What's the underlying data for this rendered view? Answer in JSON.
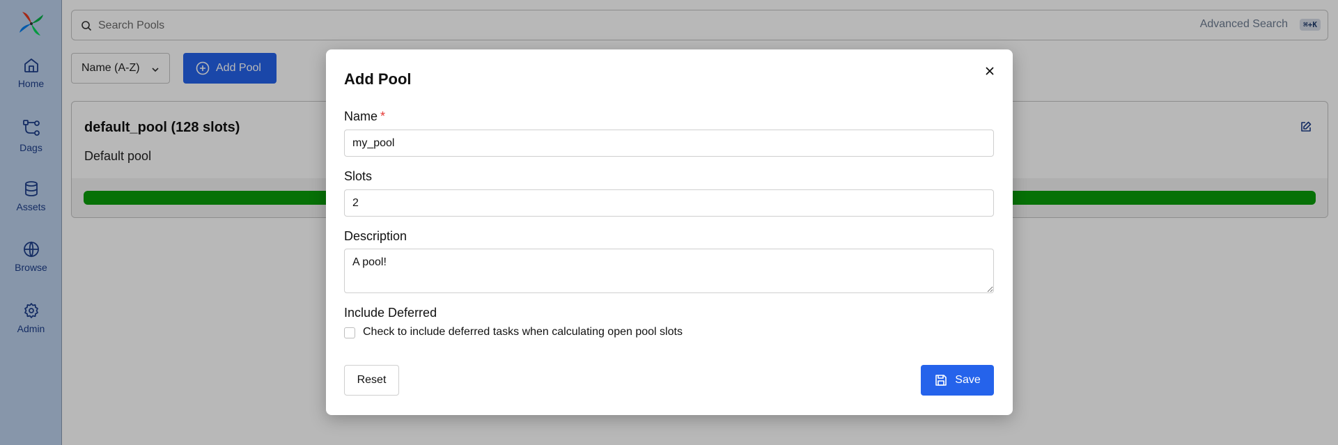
{
  "sidebar": {
    "items": [
      {
        "label": "Home",
        "icon": "home-icon"
      },
      {
        "label": "Dags",
        "icon": "dags-icon"
      },
      {
        "label": "Assets",
        "icon": "database-icon"
      },
      {
        "label": "Browse",
        "icon": "globe-icon"
      },
      {
        "label": "Admin",
        "icon": "gear-icon"
      }
    ]
  },
  "search": {
    "placeholder": "Search Pools",
    "advanced_label": "Advanced Search",
    "shortcut": "⌘+K"
  },
  "toolbar": {
    "sort_value": "Name (A-Z)",
    "add_pool_label": "Add Pool"
  },
  "pool_card": {
    "title": "default_pool (128 slots)",
    "description": "Default pool",
    "bar_color": "#0a9d0a"
  },
  "modal": {
    "title": "Add Pool",
    "name_label": "Name",
    "required_mark": "*",
    "name_value": "my_pool",
    "slots_label": "Slots",
    "slots_value": "2",
    "description_label": "Description",
    "description_value": "A pool!",
    "include_deferred_label": "Include Deferred",
    "include_deferred_text": "Check to include deferred tasks when calculating open pool slots",
    "include_deferred_checked": false,
    "reset_label": "Reset",
    "save_label": "Save"
  },
  "colors": {
    "sidebar_bg": "#bcd0ec",
    "primary": "#2563eb",
    "nav_text": "#1d3e8a"
  }
}
